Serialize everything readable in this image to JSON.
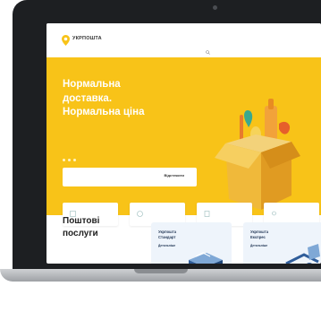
{
  "header": {
    "logo_text": "УКРПОШТА",
    "logo_sub": "",
    "top_right": "",
    "nav_items": [
      "",
      "",
      "",
      "",
      "",
      "",
      ""
    ],
    "nav_right": ""
  },
  "hero": {
    "title_line1": "Нормальна",
    "title_line2": "доставка.",
    "title_line3": "Нормальна ціна",
    "subtitle": "",
    "tracking_placeholder": "",
    "tracking_button": "Відстежити"
  },
  "services": {
    "items": [
      {
        "label": ""
      },
      {
        "label": ""
      },
      {
        "label": ""
      },
      {
        "label": ""
      }
    ]
  },
  "postal": {
    "title_line1": "Поштові",
    "title_line2": "послуги",
    "description": ""
  },
  "cards": [
    {
      "title_line1": "Укрпошта",
      "title_line2": "Стандарт",
      "link": "Детальніше"
    },
    {
      "title_line1": "Укрпошта",
      "title_line2": "Експрес",
      "link": "Детальніше"
    }
  ],
  "colors": {
    "brand_yellow": "#f8c318",
    "laptop_frame": "#1d1f22",
    "card_bg": "#eef4fb"
  }
}
